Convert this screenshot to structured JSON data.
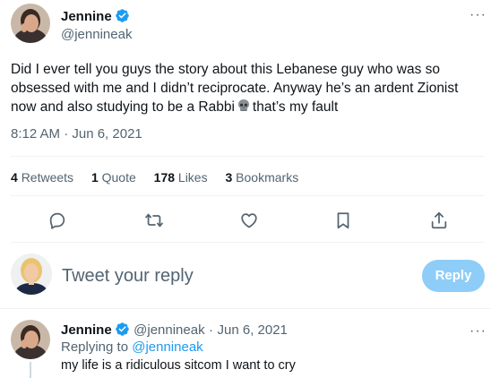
{
  "tweet": {
    "author_name": "Jennine",
    "author_handle": "@jennineak",
    "more_icon": "more-icon",
    "text": "Did I ever tell you guys the story about this Lebanese guy who was so obsessed with me and I didn’t reciprocate. Anyway he’s an ardent Zionist now and also studying to be a Rabbi",
    "text_after_emoji": "that’s my fault",
    "emoji": "skull",
    "timestamp": "8:12 AM · Jun 6, 2021"
  },
  "stats": {
    "retweets_count": "4",
    "retweets_label": "Retweets",
    "quotes_count": "1",
    "quotes_label": "Quote",
    "likes_count": "178",
    "likes_label": "Likes",
    "bookmarks_count": "3",
    "bookmarks_label": "Bookmarks"
  },
  "actions": [
    "reply-icon",
    "retweet-icon",
    "like-icon",
    "bookmark-icon",
    "share-icon"
  ],
  "composer": {
    "placeholder": "Tweet your reply",
    "button_label": "Reply"
  },
  "reply": {
    "author_name": "Jennine",
    "author_handle": "@jennineak",
    "separator": "·",
    "date": "Jun 6, 2021",
    "replying_to_label": "Replying to",
    "replying_to_handle": "@jennineak",
    "text": "my life is a ridiculous sitcom I want to cry"
  },
  "colors": {
    "accent": "#1d9bf0",
    "reply_button_disabled": "#8ecdf8",
    "secondary_text": "#536471",
    "divider": "#eff3f4"
  }
}
